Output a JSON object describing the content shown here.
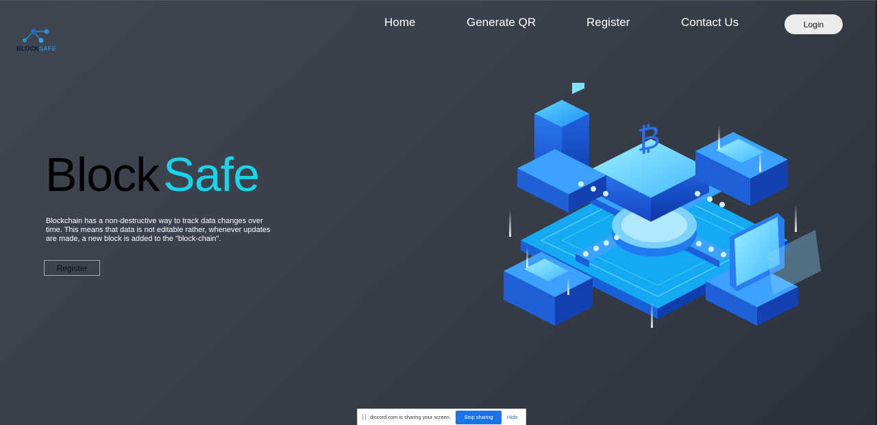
{
  "logo": {
    "word1": "BLOCK",
    "word2": "SAFE",
    "icon": "network-nodes-icon"
  },
  "nav": {
    "items": [
      {
        "label": "Home"
      },
      {
        "label": "Generate QR"
      },
      {
        "label": "Register"
      },
      {
        "label": "Contact Us"
      }
    ],
    "login_label": "Login"
  },
  "hero": {
    "title_part1": "Block",
    "title_part2": "Safe",
    "description": "Blockchain has a non-destructive way to track data changes over time. This means that data is not editable rather, whenever updates are made, a new block is added to the \"block-chain\".",
    "register_label": "Register"
  },
  "illustration": {
    "icon": "isometric-blockchain-bitcoin-illustration",
    "symbol": "₿"
  },
  "share_bar": {
    "message": "discord.com is sharing your screen.",
    "stop_label": "Stop sharing",
    "hide_label": "Hide"
  },
  "colors": {
    "accent": "#19d3e8",
    "background": "#3a414c",
    "title_dark": "#000000",
    "share_button": "#1a73e8"
  }
}
